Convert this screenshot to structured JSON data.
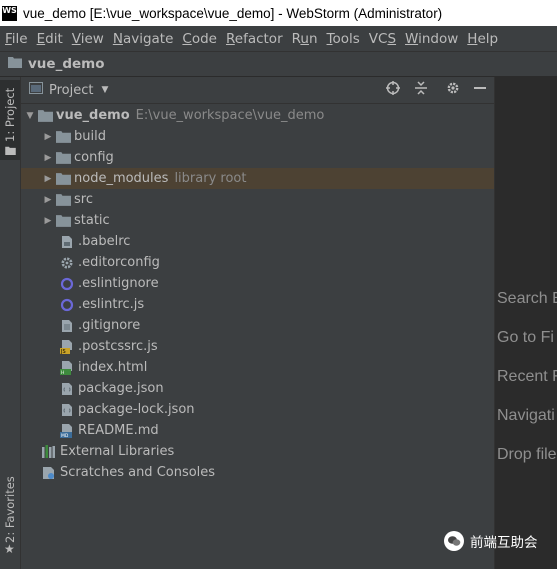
{
  "window": {
    "logo_text": "WS",
    "title": "vue_demo [E:\\vue_workspace\\vue_demo] - WebStorm (Administrator)"
  },
  "menu": [
    {
      "pre": "",
      "ul": "F",
      "post": "ile"
    },
    {
      "pre": "",
      "ul": "E",
      "post": "dit"
    },
    {
      "pre": "",
      "ul": "V",
      "post": "iew"
    },
    {
      "pre": "",
      "ul": "N",
      "post": "avigate"
    },
    {
      "pre": "",
      "ul": "C",
      "post": "ode"
    },
    {
      "pre": "",
      "ul": "R",
      "post": "efactor"
    },
    {
      "pre": "R",
      "ul": "u",
      "post": "n"
    },
    {
      "pre": "",
      "ul": "T",
      "post": "ools"
    },
    {
      "pre": "VC",
      "ul": "S",
      "post": ""
    },
    {
      "pre": "",
      "ul": "W",
      "post": "indow"
    },
    {
      "pre": "",
      "ul": "H",
      "post": "elp"
    }
  ],
  "navbar": {
    "project_name": "vue_demo"
  },
  "side": {
    "project_tab": "1: Project",
    "favorites_tab": "2: Favorites"
  },
  "pane": {
    "selector_label": "Project"
  },
  "tree": {
    "root": {
      "name": "vue_demo",
      "path": "E:\\vue_workspace\\vue_demo"
    },
    "folders": [
      "build",
      "config",
      "node_modules",
      "src",
      "static"
    ],
    "node_modules_note": "library root",
    "files": [
      {
        "name": ".babelrc",
        "icon": "babelrc-file-icon"
      },
      {
        "name": ".editorconfig",
        "icon": "gear-file-icon"
      },
      {
        "name": ".eslintignore",
        "icon": "eslint-icon"
      },
      {
        "name": ".eslintrc.js",
        "icon": "eslint-icon"
      },
      {
        "name": ".gitignore",
        "icon": "text-file-icon"
      },
      {
        "name": ".postcssrc.js",
        "icon": "js-file-icon"
      },
      {
        "name": "index.html",
        "icon": "html-file-icon"
      },
      {
        "name": "package.json",
        "icon": "json-file-icon"
      },
      {
        "name": "package-lock.json",
        "icon": "json-file-icon"
      },
      {
        "name": "README.md",
        "icon": "md-file-icon"
      }
    ],
    "external_libraries": "External Libraries",
    "scratches": "Scratches and Consoles"
  },
  "editor_hints": [
    "Search E",
    "Go to Fi",
    "Recent F",
    "Navigati",
    "Drop file"
  ],
  "watermark": "前端互助会",
  "colors": {
    "selected_row": "#4d4233",
    "folder": "#87939a",
    "eslint": "#6b68d8",
    "js": "#c9a227",
    "html": "#3d8a3d",
    "md": "#3c6d9a"
  }
}
